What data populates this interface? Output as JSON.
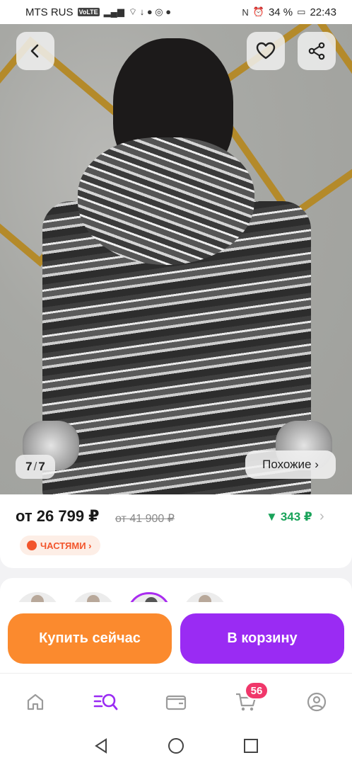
{
  "status_bar": {
    "carrier": "MTS RUS",
    "volte": "VoLTE",
    "battery": "34 %",
    "time": "22:43"
  },
  "photo": {
    "counter_current": "7",
    "counter_total": "7",
    "similar_label": "Похожие ›"
  },
  "price": {
    "current": "от 26 799 ₽",
    "old": "от 41 900 ₽",
    "cashback": "343 ₽",
    "parts_label": "ЧАСТЯМИ ›"
  },
  "actions": {
    "buy_now": "Купить сейчас",
    "add_to_cart": "В корзину"
  },
  "tab_bar": {
    "cart_badge": "56",
    "items": [
      "home-icon",
      "catalog-search-icon",
      "wallet-icon",
      "cart-icon",
      "profile-icon"
    ]
  },
  "colors": {
    "accent_purple": "#9a2bf3",
    "accent_orange": "#fb8a2e",
    "cashback_green": "#1aa35a",
    "badge_pink": "#f0376a",
    "parts_orange": "#f2552c"
  }
}
